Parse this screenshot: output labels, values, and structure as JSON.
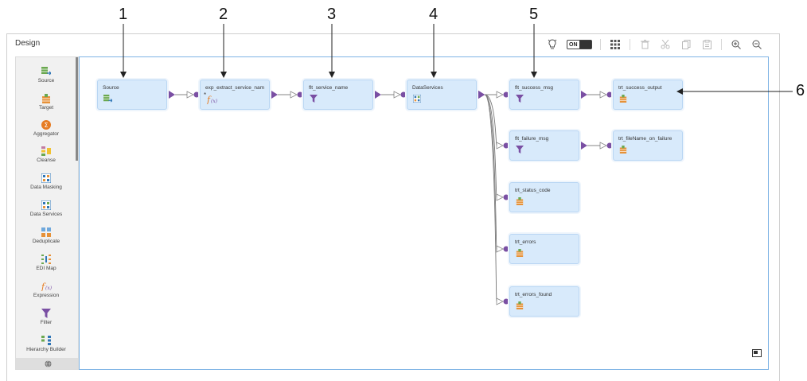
{
  "callouts": [
    "1",
    "2",
    "3",
    "4",
    "5",
    "6"
  ],
  "design": {
    "title": "Design",
    "toolbar": {
      "hint_icon": "lightbulb-icon",
      "toggle_label": "ON",
      "icons": [
        "grid-layout-icon",
        "delete-icon",
        "cut-icon",
        "copy-icon",
        "paste-icon",
        "zoom-in-icon",
        "zoom-out-icon"
      ]
    }
  },
  "palette": {
    "items": [
      {
        "label": "Source",
        "icon": "source-icon"
      },
      {
        "label": "Target",
        "icon": "target-icon"
      },
      {
        "label": "Aggregator",
        "icon": "aggregator-icon"
      },
      {
        "label": "Cleanse",
        "icon": "cleanse-icon"
      },
      {
        "label": "Data Masking",
        "icon": "data-masking-icon"
      },
      {
        "label": "Data Services",
        "icon": "data-services-icon"
      },
      {
        "label": "Deduplicate",
        "icon": "deduplicate-icon"
      },
      {
        "label": "EDI Map",
        "icon": "edi-map-icon"
      },
      {
        "label": "Expression",
        "icon": "expression-icon"
      },
      {
        "label": "Filter",
        "icon": "filter-icon"
      },
      {
        "label": "Hierarchy Builder",
        "icon": "hierarchy-builder-icon"
      }
    ],
    "footer_icon": "globe-icon"
  },
  "nodes": [
    {
      "id": "source",
      "label": "Source",
      "icon": "source-icon"
    },
    {
      "id": "expr",
      "label": "exp_extract_service_nam",
      "icon": "expression-icon"
    },
    {
      "id": "flt_service",
      "label": "flt_service_name",
      "icon": "filter-icon"
    },
    {
      "id": "dataservices",
      "label": "DataServices",
      "icon": "data-services-icon"
    },
    {
      "id": "flt_success",
      "label": "flt_success_msg",
      "icon": "filter-icon"
    },
    {
      "id": "tgt_success",
      "label": "trt_success_output",
      "icon": "target-icon"
    },
    {
      "id": "flt_failure",
      "label": "flt_failure_msg",
      "icon": "filter-icon"
    },
    {
      "id": "tgt_failure",
      "label": "trt_fileName_on_failure",
      "icon": "target-icon"
    },
    {
      "id": "tgt_status",
      "label": "trt_status_code",
      "icon": "target-icon"
    },
    {
      "id": "tgt_errors",
      "label": "trt_errors",
      "icon": "target-icon"
    },
    {
      "id": "tgt_errors_found",
      "label": "trt_errors_found",
      "icon": "target-icon"
    }
  ],
  "colors": {
    "node_fill": "#d8eafb",
    "connector": "#7a4fa3",
    "canvas_border": "#7fb4e5"
  },
  "minimap_icon": "minimap-icon"
}
